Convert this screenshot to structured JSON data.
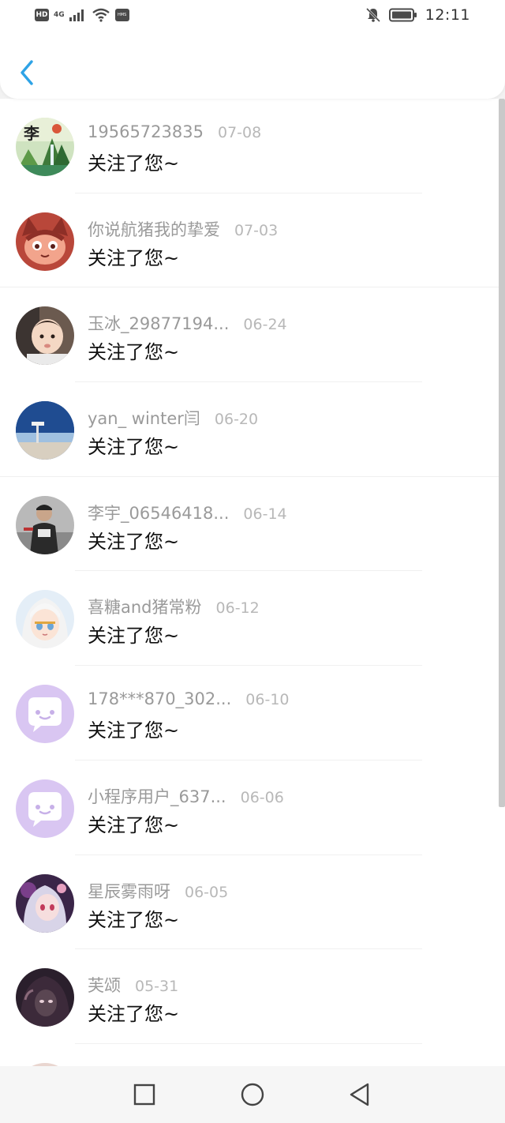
{
  "status_bar": {
    "hd": "HD",
    "network": "4G",
    "hms": "HMS",
    "time": "12:11"
  },
  "follows": {
    "items": [
      {
        "name": "19565723835",
        "date": "07-08",
        "message": "关注了您~",
        "avatar": "landscape-avatar",
        "avatar_text": "李"
      },
      {
        "name": "你说航猪我的挚爱",
        "date": "07-03",
        "message": "关注了您~",
        "avatar": "cartoon-avatar"
      },
      {
        "name": "玉冰_29877194...",
        "date": "06-24",
        "message": "关注了您~",
        "avatar": "baby-photo-avatar"
      },
      {
        "name": "yan_ winter闫",
        "date": "06-20",
        "message": "关注了您~",
        "avatar": "sky-photo-avatar"
      },
      {
        "name": "李宇_06546418...",
        "date": "06-14",
        "message": "关注了您~",
        "avatar": "person-photo-avatar"
      },
      {
        "name": "喜糖and猪常粉",
        "date": "06-12",
        "message": "关注了您~",
        "avatar": "anime-avatar"
      },
      {
        "name": "178***870_302...",
        "date": "06-10",
        "message": "关注了您~",
        "avatar": "default-chat-avatar"
      },
      {
        "name": "小程序用户_637...",
        "date": "06-06",
        "message": "关注了您~",
        "avatar": "default-chat-avatar"
      },
      {
        "name": "星辰雾雨呀",
        "date": "06-05",
        "message": "关注了您~",
        "avatar": "anime-avatar"
      },
      {
        "name": "芙颂",
        "date": "05-31",
        "message": "关注了您~",
        "avatar": "anime-avatar"
      }
    ]
  },
  "colors": {
    "accent": "#2ea3e6",
    "default_avatar_bg": "#d9c6f2",
    "default_avatar_fg": "#ffffff"
  }
}
